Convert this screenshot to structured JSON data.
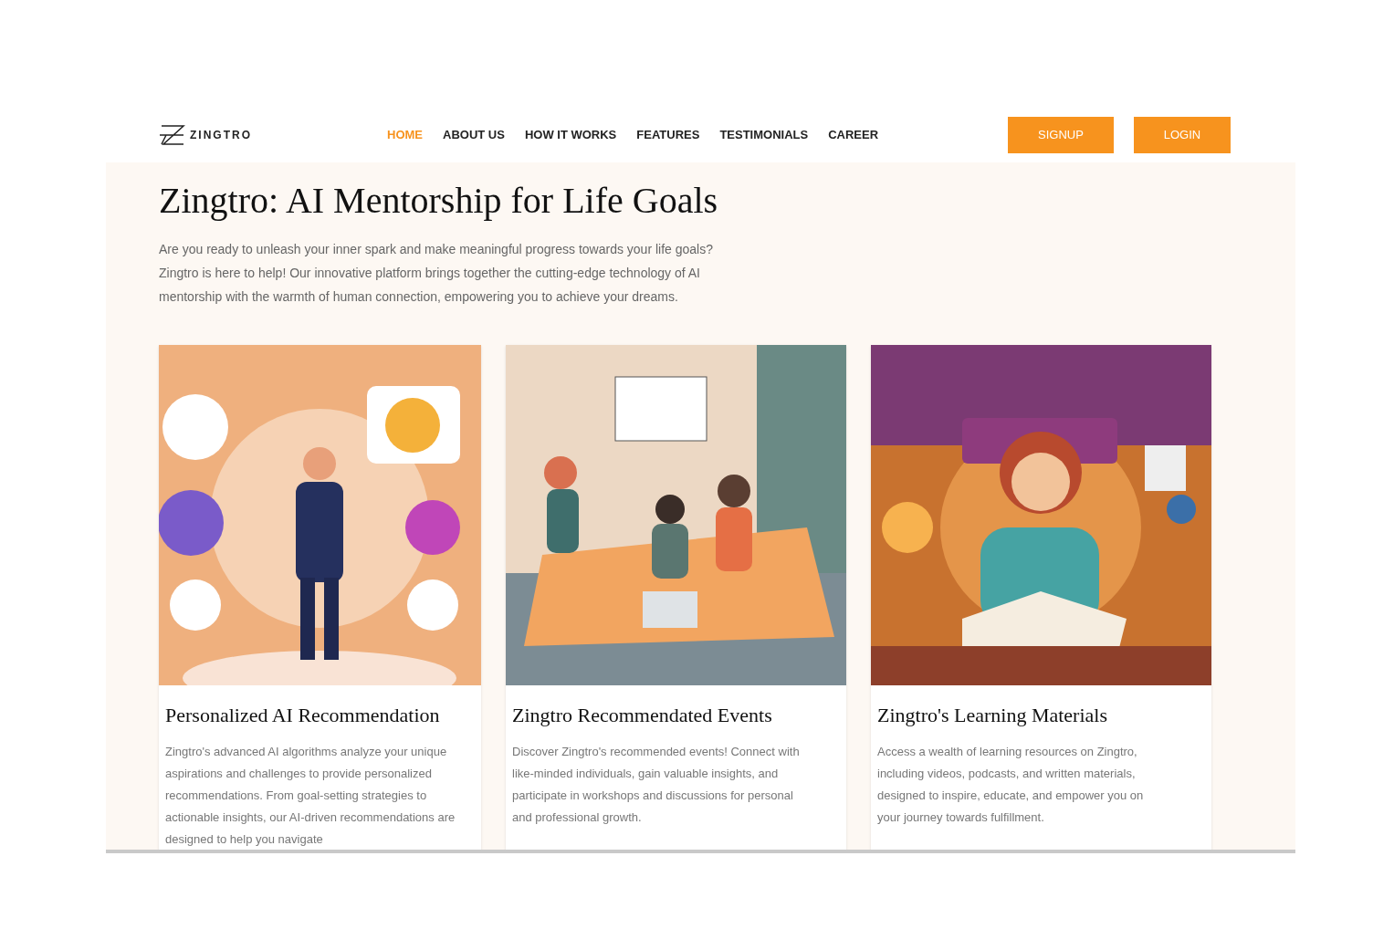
{
  "header": {
    "logo": "ZINGTRO",
    "nav": [
      {
        "label": "HOME",
        "selected": true
      },
      {
        "label": "ABOUT US",
        "selected": false
      },
      {
        "label": "HOW IT WORKS",
        "selected": false
      },
      {
        "label": "FEATURES",
        "selected": false
      },
      {
        "label": "TESTIMONIALS",
        "selected": false
      },
      {
        "label": "CAREER",
        "selected": false
      }
    ],
    "buttons": [
      "SIGNUP",
      "LOGIN"
    ]
  },
  "hero": {
    "title": "Zingtro: AI Mentorship for Life Goals",
    "text": "Are you ready to unleash your inner spark and make meaningful progress towards your life goals? Zingtro is here to help! Our innovative platform brings together the cutting-edge technology of AI mentorship with the warmth of human connection, empowering you to achieve your dreams."
  },
  "cards": [
    {
      "kind": "picture",
      "title": "Personalized AI Recommendation",
      "text": "Zingtro's advanced AI algorithms analyze your unique aspirations and challenges to provide personalized recommendations. From goal-setting strategies to actionable insights, our AI-driven recommendations are designed to help you navigate"
    },
    {
      "kind": "picture",
      "title": "Zingtro Recommendated Events",
      "text": "Discover Zingtro's recommended events! Connect with like-minded individuals, gain valuable insights, and participate in workshops and discussions for personal and professional growth."
    },
    {
      "kind": "picture",
      "title": "Zingtro's Learning Materials",
      "text": "Access a wealth of learning resources on Zingtro, including videos, podcasts, and written materials, designed to inspire, educate, and empower you on your journey towards fulfillment."
    }
  ]
}
